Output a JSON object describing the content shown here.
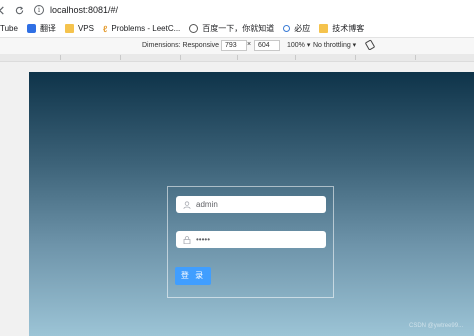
{
  "browser": {
    "url": "localhost:8081/#/"
  },
  "bookmarks": [
    {
      "label": "Tube",
      "icon": "none"
    },
    {
      "label": "翻译",
      "icon": "translate-icon"
    },
    {
      "label": "VPS",
      "icon": "folder-icon"
    },
    {
      "label": "Problems - LeetC...",
      "icon": "leetcode-icon"
    },
    {
      "label": "百度一下，你就知道",
      "icon": "globe-icon"
    },
    {
      "label": "必应",
      "icon": "search-icon"
    },
    {
      "label": "技术博客",
      "icon": "folder-icon"
    }
  ],
  "devtools": {
    "dimensions_label": "Dimensions: Responsive ▾",
    "width": "793",
    "times": "×",
    "height": "604",
    "zoom": "100% ▾",
    "throttle": "No throttling ▾"
  },
  "login": {
    "username_value": "admin",
    "password_value": "•••••",
    "button_label": "登 录",
    "button_color": "#409eff"
  },
  "colors": {
    "gradient_top": "#0e3349",
    "gradient_bottom": "#9cc4d6"
  },
  "watermark": "CSDN @ywtree99..."
}
